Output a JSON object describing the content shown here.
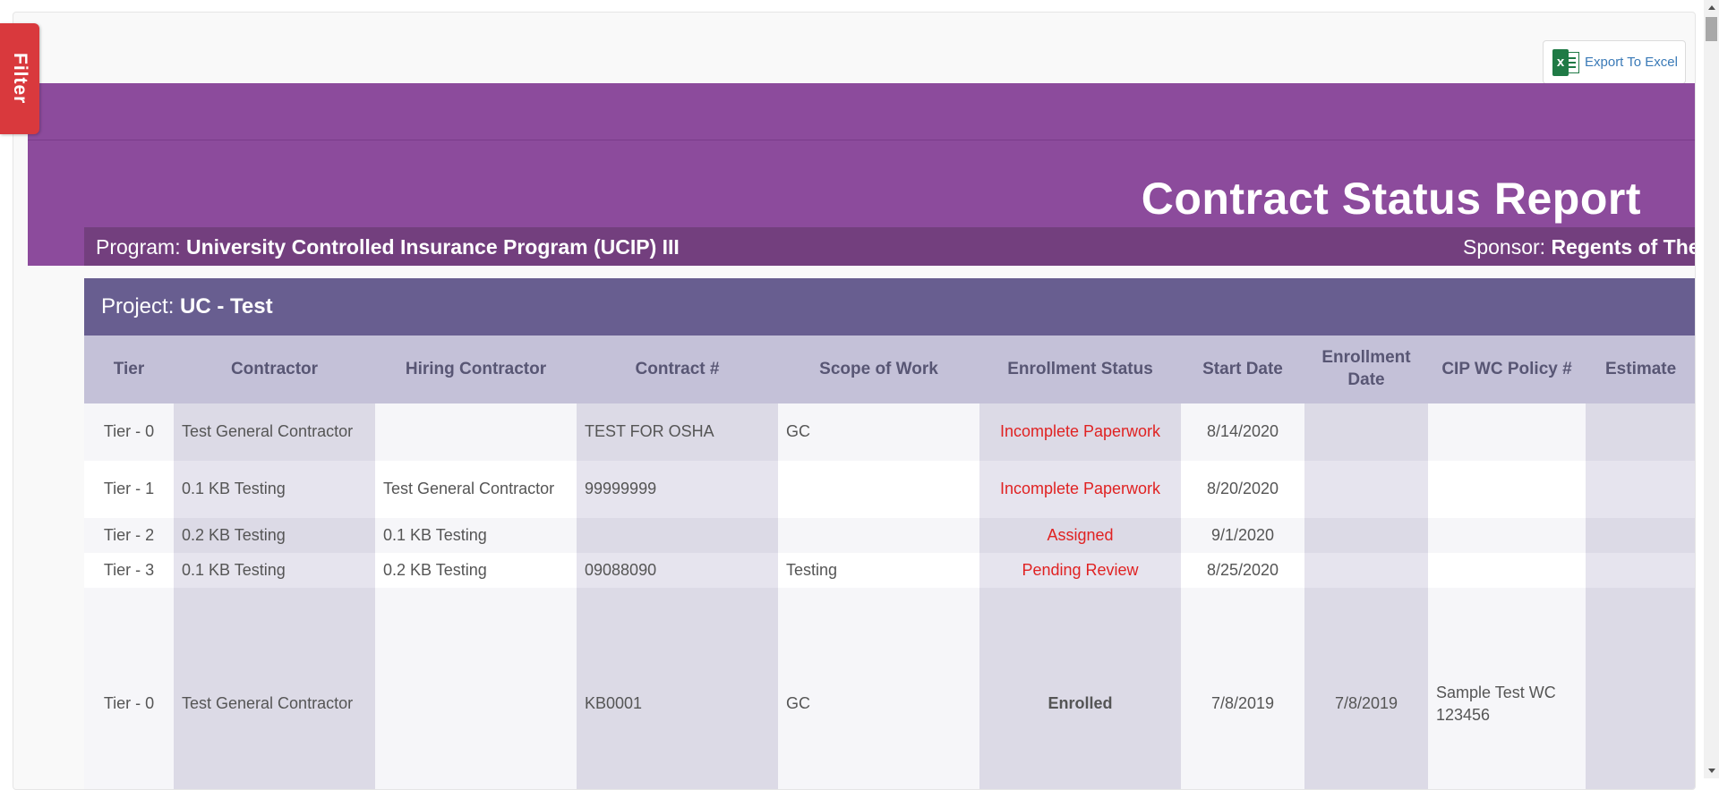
{
  "filter_tab": {
    "label": "Filter"
  },
  "export": {
    "label": "Export To Excel",
    "icon": "excel-icon"
  },
  "report": {
    "title": "Contract Status Report"
  },
  "info": {
    "program_label": "Program:",
    "program_value": "University Controlled Insurance Program (UCIP) III",
    "sponsor_label": "Sponsor:",
    "sponsor_value": "Regents of The Univ"
  },
  "project": {
    "label": "Project:",
    "value": "UC - Test"
  },
  "table": {
    "headers": [
      "Tier",
      "Contractor",
      "Hiring Contractor",
      "Contract #",
      "Scope of Work",
      "Enrollment Status",
      "Start Date",
      "Enrollment Date",
      "CIP WC Policy #",
      "Estimate"
    ],
    "rows": [
      [
        "Tier - 0",
        "Test General Contractor",
        "",
        "TEST FOR OSHA",
        "GC",
        "Incomplete Paperwork",
        "8/14/2020",
        "",
        "",
        ""
      ],
      [
        "Tier - 1",
        "0.1 KB Testing",
        "Test General Contractor",
        "99999999",
        "",
        "Incomplete Paperwork",
        "8/20/2020",
        "",
        "",
        ""
      ],
      [
        "Tier - 2",
        "0.2 KB Testing",
        "0.1 KB Testing",
        "",
        "",
        "Assigned",
        "9/1/2020",
        "",
        "",
        ""
      ],
      [
        "Tier - 3",
        "0.1 KB Testing",
        "0.2 KB Testing",
        "09088090",
        "Testing",
        "Pending Review",
        "8/25/2020",
        "",
        "",
        ""
      ],
      [
        "Tier - 0",
        "Test General Contractor",
        "",
        "KB0001",
        "GC",
        "Enrolled",
        "7/8/2019",
        "7/8/2019",
        "Sample Test WC 123456",
        ""
      ]
    ]
  },
  "colors": {
    "banner": "#8c4b9c",
    "info_bar": "#733f7e",
    "project_bar": "#685e90",
    "header_row": "#c4c1d8",
    "filter_tab": "#d9393d",
    "status_red": "#e02222"
  }
}
